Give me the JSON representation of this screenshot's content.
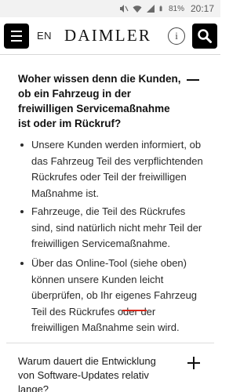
{
  "status_bar": {
    "battery": "81%",
    "time": "20:17"
  },
  "header": {
    "language": "EN",
    "logo": "DAIMLER",
    "info_glyph": "i"
  },
  "faq": {
    "open_item": {
      "question": "Woher wissen denn die Kunden, ob ein Fahrzeug in der freiwilligen Servicemaßnahme ist oder im Rückruf?",
      "answers": [
        "Unsere Kunden werden informiert, ob das Fahrzeug Teil des verpflichtenden Rückrufes oder Teil der freiwilligen Maßnahme ist.",
        "Fahrzeuge, die Teil des Rückrufes sind, sind natürlich nicht mehr Teil der freiwilligen Servicemaßnahme.",
        "Über das Online-Tool (siehe oben) können unsere Kunden leicht überprüfen, ob Ihr eigenes Fahrzeug Teil des Rückrufes oder der freiwilligen Maßnahme sein wird."
      ]
    },
    "closed_item": {
      "question": "Warum dauert die Entwicklung von Software-Updates relativ lange?"
    }
  },
  "icons": {
    "menu": "hamburger-menu-icon",
    "info": "info-circle-icon",
    "search": "search-icon",
    "collapse": "minus-icon",
    "expand": "plus-icon"
  },
  "colors": {
    "accent_black": "#000000",
    "underline_red": "#d9281a",
    "statusbar_bg": "#f2f2f2"
  }
}
